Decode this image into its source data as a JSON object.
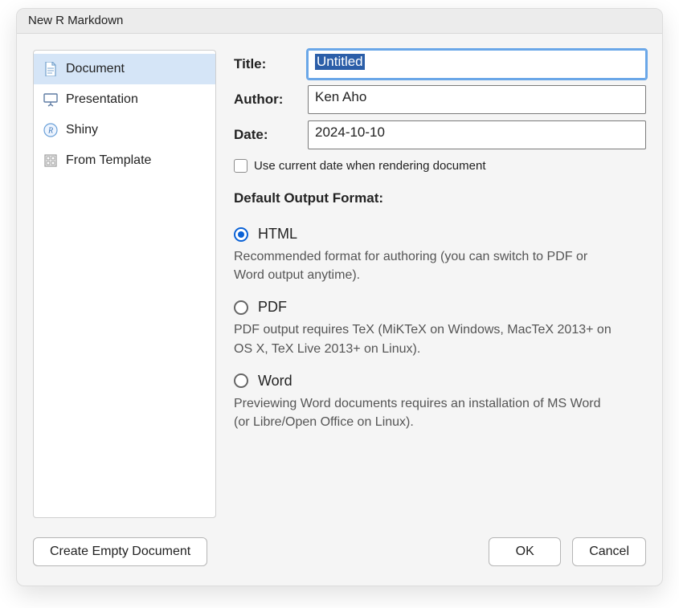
{
  "dialog": {
    "title": "New R Markdown"
  },
  "sidebar": {
    "items": [
      {
        "label": "Document"
      },
      {
        "label": "Presentation"
      },
      {
        "label": "Shiny"
      },
      {
        "label": "From Template"
      }
    ]
  },
  "form": {
    "title_label": "Title:",
    "title_value": "Untitled",
    "author_label": "Author:",
    "author_value": "Ken Aho",
    "date_label": "Date:",
    "date_value": "2024-10-10",
    "use_current_date_label": "Use current date when rendering document",
    "use_current_date_checked": false,
    "output_format_header": "Default Output Format:",
    "formats": [
      {
        "key": "html",
        "label": "HTML",
        "selected": true,
        "description": "Recommended format for authoring (you can switch to PDF or Word output anytime)."
      },
      {
        "key": "pdf",
        "label": "PDF",
        "selected": false,
        "description": "PDF output requires TeX (MiKTeX on Windows, MacTeX 2013+ on OS X, TeX Live 2013+ on Linux)."
      },
      {
        "key": "word",
        "label": "Word",
        "selected": false,
        "description": "Previewing Word documents requires an installation of MS Word (or Libre/Open Office on Linux)."
      }
    ]
  },
  "buttons": {
    "create_empty": "Create Empty Document",
    "ok": "OK",
    "cancel": "Cancel"
  }
}
